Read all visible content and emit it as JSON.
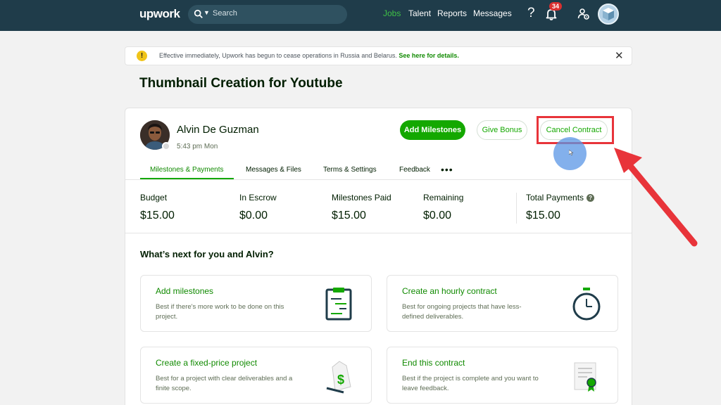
{
  "nav": {
    "logo": "upwork",
    "search_placeholder": "Search",
    "links": [
      "Jobs",
      "Talent",
      "Reports",
      "Messages"
    ],
    "active_link": "Jobs",
    "help": "?",
    "notification_count": "34"
  },
  "banner": {
    "icon": "!",
    "text": "Effective immediately, Upwork has begun to cease operations in Russia and Belarus. ",
    "link": "See here for details.",
    "close": "✕"
  },
  "page": {
    "title": "Thumbnail Creation for Youtube"
  },
  "freelancer": {
    "name": "Alvin De Guzman",
    "local_time": "5:43 pm Mon"
  },
  "actions": {
    "add_milestones": "Add Milestones",
    "give_bonus": "Give Bonus",
    "cancel_contract": "Cancel Contract"
  },
  "tabs": [
    "Milestones & Payments",
    "Messages & Files",
    "Terms & Settings",
    "Feedback"
  ],
  "tabs_more": "•••",
  "stats": [
    {
      "label": "Budget",
      "value": "$15.00"
    },
    {
      "label": "In Escrow",
      "value": "$0.00"
    },
    {
      "label": "Milestones Paid",
      "value": "$15.00"
    },
    {
      "label": "Remaining",
      "value": "$0.00"
    },
    {
      "label": "Total Payments",
      "value": "$15.00"
    }
  ],
  "stats_help": "?",
  "next": {
    "heading": "What’s next for you and Alvin?",
    "cards": [
      {
        "title": "Add milestones",
        "desc": "Best if there's more work to be done on this project.",
        "icon": "clipboard-icon"
      },
      {
        "title": "Create an hourly contract",
        "desc": "Best for ongoing projects that have less-defined deliverables.",
        "icon": "stopwatch-icon"
      },
      {
        "title": "Create a fixed-price project",
        "desc": "Best for a project with clear deliverables and a finite scope.",
        "icon": "price-tag-icon"
      },
      {
        "title": "End this contract",
        "desc": "Best if the project is complete and you want to leave feedback.",
        "icon": "certificate-icon"
      }
    ]
  },
  "colors": {
    "nav_bg": "#1f3c4a",
    "brand_green": "#14a800",
    "highlight_red": "#e8343a"
  }
}
